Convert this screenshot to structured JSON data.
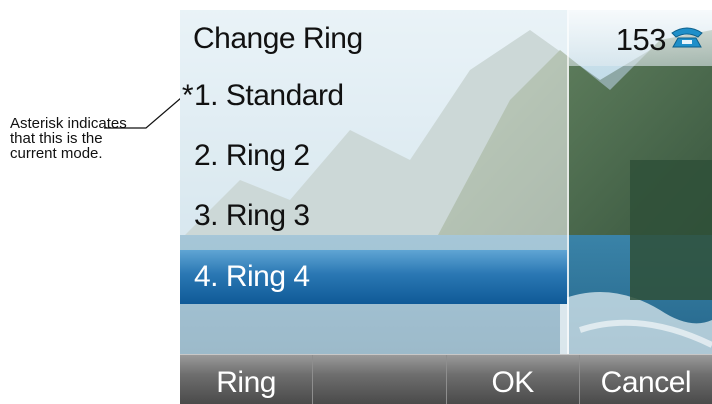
{
  "callout": {
    "text": "Asterisk indicates that this is the current mode."
  },
  "menu": {
    "title": "Change Ring",
    "items": [
      {
        "marker": "*",
        "label": "1.  Standard",
        "selected": false
      },
      {
        "marker": "",
        "label": "2.  Ring  2",
        "selected": false
      },
      {
        "marker": "",
        "label": "3.  Ring  3",
        "selected": false
      },
      {
        "marker": "",
        "label": "4.  Ring 4",
        "selected": true
      }
    ]
  },
  "status": {
    "extension": "153",
    "icon": "desk-phone-icon"
  },
  "softkeys": [
    {
      "label": "Ring"
    },
    {
      "label": ""
    },
    {
      "label": "OK"
    },
    {
      "label": "Cancel"
    }
  ],
  "colors": {
    "selection": "#2a77b3",
    "softkey_bar": "#6e6e6e",
    "phone_icon": "#1f8fc9"
  }
}
